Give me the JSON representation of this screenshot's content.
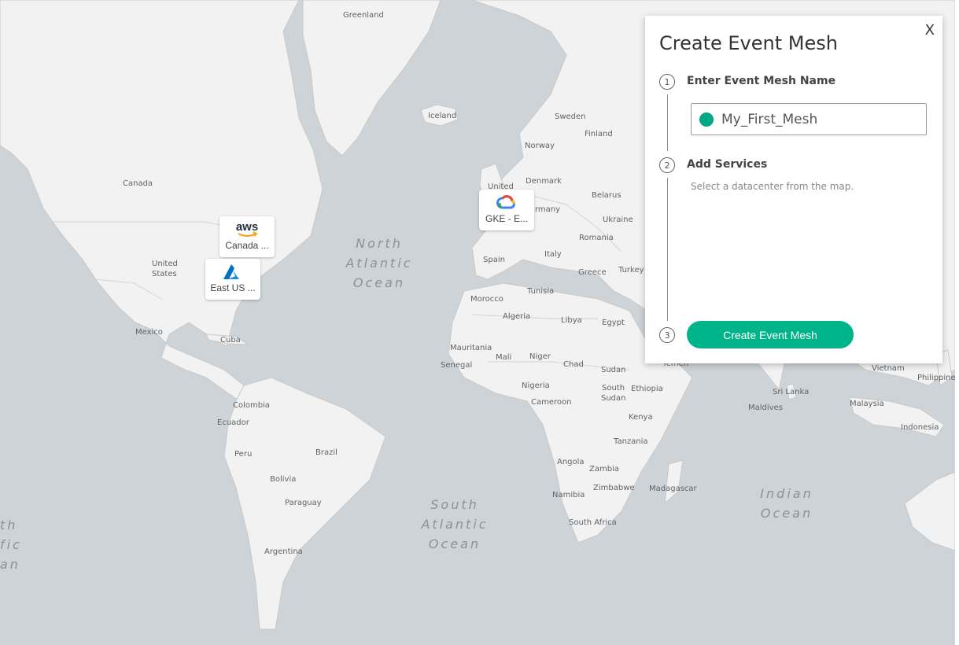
{
  "map": {
    "labels": [
      "Greenland",
      "Iceland",
      "Sweden",
      "Finland",
      "Norway",
      "Denmark",
      "United",
      "Belarus",
      "rmany",
      "Ukraine",
      "Romania",
      "Italy",
      "Spain",
      "Greece",
      "Turkey",
      "Tunisia",
      "Morocco",
      "Algeria",
      "Libya",
      "Egypt",
      "Mauritania",
      "Mali",
      "Niger",
      "Chad",
      "Sudan",
      "Senegal",
      "Nigeria",
      "Cameroon",
      "South",
      "Sudan",
      "Ethiopia",
      "Kenya",
      "Tanzania",
      "Angola",
      "Zambia",
      "Zimbabwe",
      "Namibia",
      "Madagascar",
      "South Africa",
      "Yemen",
      "Vietnam",
      "Philippine",
      "Sri Lanka",
      "Maldives",
      "Malaysia",
      "Indonesia",
      "Canada",
      "United",
      "States",
      "Mexico",
      "Cuba",
      "Colombia",
      "Ecuador",
      "Peru",
      "Brazil",
      "Bolivia",
      "Paraguay",
      "Argentina"
    ],
    "oceans": [
      {
        "lines": [
          "North",
          "Atlantic",
          "Ocean"
        ]
      },
      {
        "lines": [
          "South",
          "Atlantic",
          "Ocean"
        ]
      },
      {
        "lines": [
          "Indian",
          "Ocean"
        ]
      },
      {
        "lines": [
          "th",
          "fic",
          "an"
        ]
      }
    ]
  },
  "markers": [
    {
      "provider": "aws",
      "logo_text": "aws",
      "label": "Canada ..."
    },
    {
      "provider": "azure",
      "label": "East US ..."
    },
    {
      "provider": "gcp",
      "label": "GKE - E..."
    }
  ],
  "panel": {
    "title": "Create Event Mesh",
    "close": "X",
    "steps": [
      {
        "number": "1",
        "label": "Enter Event Mesh Name"
      },
      {
        "number": "2",
        "label": "Add Services"
      },
      {
        "number": "3"
      }
    ],
    "mesh_name": "My_First_Mesh",
    "hint": "Select a datacenter from the map.",
    "create_button": "Create Event Mesh"
  },
  "colors": {
    "accent": "#00b48a",
    "status": "#00a885",
    "water": "#cdd3d6",
    "land": "#f2f2f2"
  }
}
